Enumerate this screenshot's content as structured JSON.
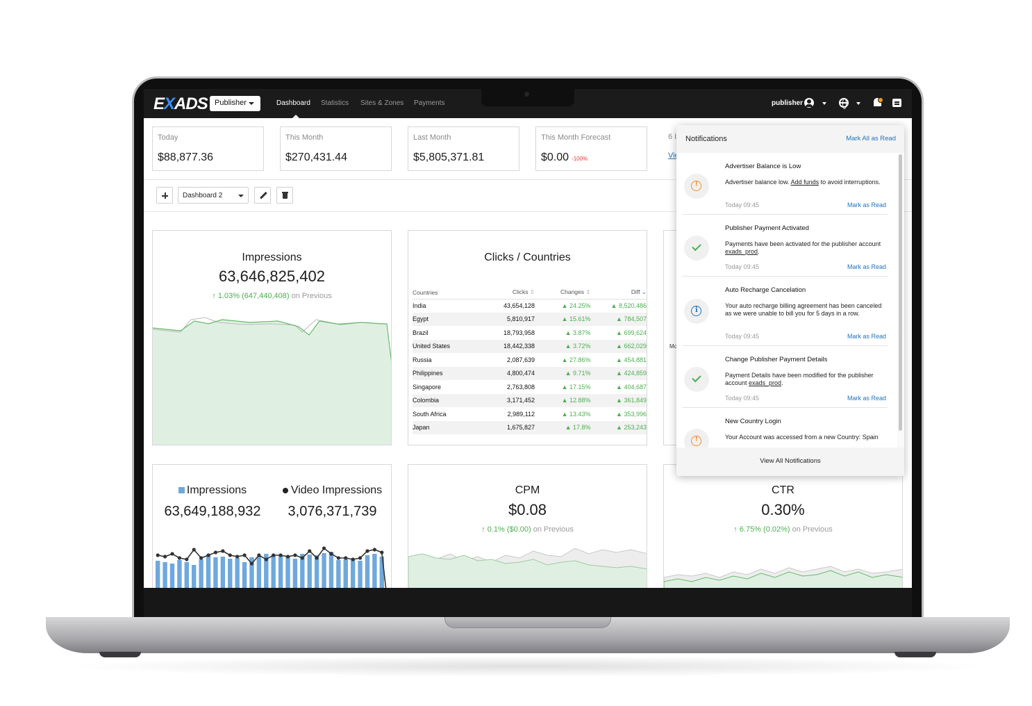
{
  "nav": {
    "logo": "EXADS",
    "role": "Publisher",
    "items": [
      "Dashboard",
      "Statistics",
      "Sites & Zones",
      "Payments"
    ],
    "active": "Dashboard",
    "username": "publisher"
  },
  "summary": [
    {
      "label": "Today",
      "value": "$88,877.36",
      "change": ""
    },
    {
      "label": "This Month",
      "value": "$270,431.44",
      "change": ""
    },
    {
      "label": "Last Month",
      "value": "$5,805,371.81",
      "change": ""
    },
    {
      "label": "This Month Forecast",
      "value": "$0.00",
      "change": "-100%"
    }
  ],
  "summary_partial": {
    "label": "6 I",
    "link": "Vie"
  },
  "toolbar": {
    "dashboard_name": "Dashboard 2"
  },
  "impressions_widget": {
    "title": "Impressions",
    "value": "63,646,825,402",
    "delta": "↑ 1.03% (647,440,408)",
    "delta_suffix": "on Previous"
  },
  "countries_widget": {
    "title": "Clicks / Countries",
    "columns": [
      "Countries",
      "Clicks",
      "Changes",
      "Diff"
    ],
    "rows": [
      {
        "country": "India",
        "clicks": "43,654,128",
        "change": "▲ 24.25%",
        "diff": "▲ 8,520,486"
      },
      {
        "country": "Egypt",
        "clicks": "5,810,917",
        "change": "▲ 15.61%",
        "diff": "▲ 784,507"
      },
      {
        "country": "Brazil",
        "clicks": "18,793,958",
        "change": "▲ 3.87%",
        "diff": "▲ 699,624"
      },
      {
        "country": "United States",
        "clicks": "18,442,338",
        "change": "▲ 3.72%",
        "diff": "▲ 662,029"
      },
      {
        "country": "Russia",
        "clicks": "2,087,639",
        "change": "▲ 27.86%",
        "diff": "▲ 454,881"
      },
      {
        "country": "Philippines",
        "clicks": "4,800,474",
        "change": "▲ 9.71%",
        "diff": "▲ 424,859"
      },
      {
        "country": "Singapore",
        "clicks": "2,763,808",
        "change": "▲ 17.15%",
        "diff": "▲ 404,687"
      },
      {
        "country": "Colombia",
        "clicks": "3,171,452",
        "change": "▲ 12.88%",
        "diff": "▲ 361,849"
      },
      {
        "country": "South Africa",
        "clicks": "2,989,112",
        "change": "▲ 13.43%",
        "diff": "▲ 353,996"
      },
      {
        "country": "Japan",
        "clicks": "1,675,827",
        "change": "▲ 17.8%",
        "diff": "▲ 253,243"
      }
    ]
  },
  "partial_widget_label": "Mo",
  "dual_widget": {
    "left_label": "Impressions",
    "left_value": "63,649,188,932",
    "right_label": "Video Impressions",
    "right_value": "3,076,371,739"
  },
  "cpm_widget": {
    "title": "CPM",
    "value": "$0.08",
    "delta": "↑ 0.1% ($0.00)",
    "delta_suffix": "on Previous"
  },
  "ctr_widget": {
    "title": "CTR",
    "value": "0.30%",
    "delta": "↑ 6.75% (0.02%)",
    "delta_suffix": "on Previous"
  },
  "notifications": {
    "title": "Notifications",
    "mark_all": "Mark All as Read",
    "footer": "View All Notifications",
    "items": [
      {
        "type": "warning",
        "title": "Advertiser Balance is Low",
        "body_pre": "Advertiser balance low. ",
        "body_link": "Add funds",
        "body_post": " to avoid interruptions.",
        "time": "Today 09:45",
        "action": "Mark as Read"
      },
      {
        "type": "success",
        "title": "Publisher Payment Activated",
        "body_pre": "Payments have been activated for the publisher account ",
        "body_link": "exads_prod",
        "body_post": ".",
        "time": "Today 09:45",
        "action": "Mark as Read"
      },
      {
        "type": "info",
        "title": "Auto Recharge Cancelation",
        "body_pre": "Your auto recharge billing agreement has been canceled as we were unable to bill you for 5 days in a row.",
        "body_link": "",
        "body_post": "",
        "time": "Today 09:45",
        "action": "Mark as Read"
      },
      {
        "type": "success",
        "title": "Change Publisher Payment Details",
        "body_pre": "Payment Details have been modified for the publisher account ",
        "body_link": "exads_prod",
        "body_post": ".",
        "time": "Today 09:45",
        "action": "Mark as Read"
      },
      {
        "type": "warning",
        "title": "New Country Login",
        "body_pre": "Your Account was accessed from a new Country: Spain",
        "body_link": "",
        "body_post": "",
        "time": "",
        "action": ""
      }
    ]
  },
  "colors": {
    "positive": "#4caf50",
    "negative": "#e53935",
    "link": "#1e73be",
    "area_fill": "#dff0e3",
    "bar": "#6fa8dc",
    "warning": "#f28c28"
  }
}
